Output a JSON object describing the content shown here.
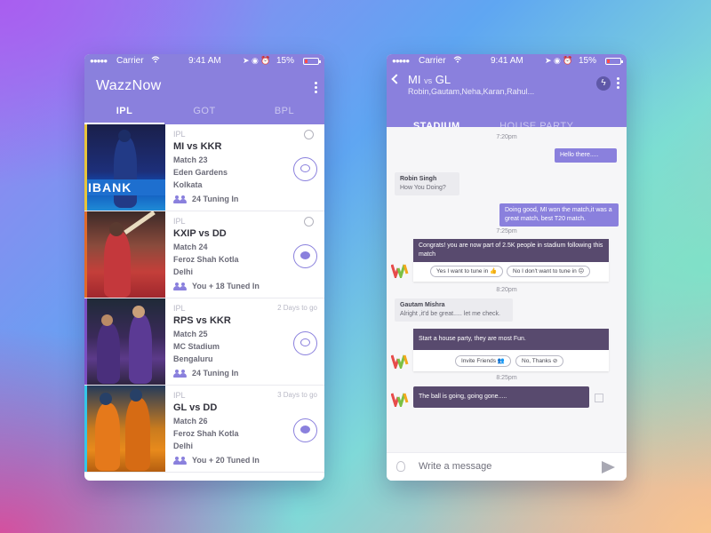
{
  "status": {
    "carrier": "Carrier",
    "time": "9:41 AM",
    "battery": "15%",
    "signal_icon": "signal-dots-icon",
    "wifi_icon": "wifi-icon"
  },
  "left": {
    "app_name": "WazzNow",
    "tabs": [
      {
        "label": "IPL",
        "active": true
      },
      {
        "label": "GOT",
        "active": false
      },
      {
        "label": "BPL",
        "active": false
      }
    ],
    "matches": [
      {
        "league": "IPL",
        "title": "MI vs KKR",
        "match": "Match 23",
        "venue": "Eden Gardens",
        "city": "Kolkata",
        "tuning": "24 Tuning In",
        "when": "",
        "edge": "#e8c53a"
      },
      {
        "league": "IPL",
        "title": "KXIP vs DD",
        "match": "Match 24",
        "venue": "Feroz Shah Kotla",
        "city": "Delhi",
        "tuning": "You + 18 Tuned In",
        "when": "",
        "edge": "#e06a2a"
      },
      {
        "league": "IPL",
        "title": "RPS vs KKR",
        "match": "Match 25",
        "venue": "MC Stadium",
        "city": "Bengaluru",
        "tuning": "24 Tuning In",
        "when": "2 Days  to go",
        "edge": "#7d4fc4"
      },
      {
        "league": "IPL",
        "title": "GL vs DD",
        "match": "Match 26",
        "venue": "Feroz Shah Kotla",
        "city": "Delhi",
        "tuning": "You + 20 Tuned In",
        "when": "3 Days to go",
        "edge": "#35c6e8"
      }
    ],
    "accent": "#8a80dd"
  },
  "right": {
    "title": "MI",
    "vs": "vs",
    "title2": "GL",
    "participants": "Robin,Gautam,Neha,Karan,Rahul...",
    "tabs": [
      {
        "label": "STADIUM",
        "active": true
      },
      {
        "label": "HOUSE PARTY",
        "active": false
      }
    ],
    "messages": {
      "t1": "7:20pm",
      "m1": "Hello there.....",
      "robin_name": "Robin Singh",
      "robin_text": "How You Doing?",
      "m2": "Doing good, MI won the match,it was a great match, best T20 match.",
      "t2": "7:25pm",
      "bot1": "Congrats! you are now part of 2.5K people in stadium following this match",
      "chip_yes": "Yes I want to tune in",
      "chip_no": "No I don't want to tune in",
      "t3": "8:20pm",
      "gautam_name": "Gautam Mishra",
      "gautam_text": "Alright ,it'd be great..... let me check.",
      "bot2": "Start a house party, they are most Fun.",
      "chip_invite": "Invite Friends",
      "chip_thanks": "No, Thanks",
      "t4": "8:25pm",
      "bot3": "The ball is going, going gone....."
    },
    "input_placeholder": "Write a message"
  }
}
